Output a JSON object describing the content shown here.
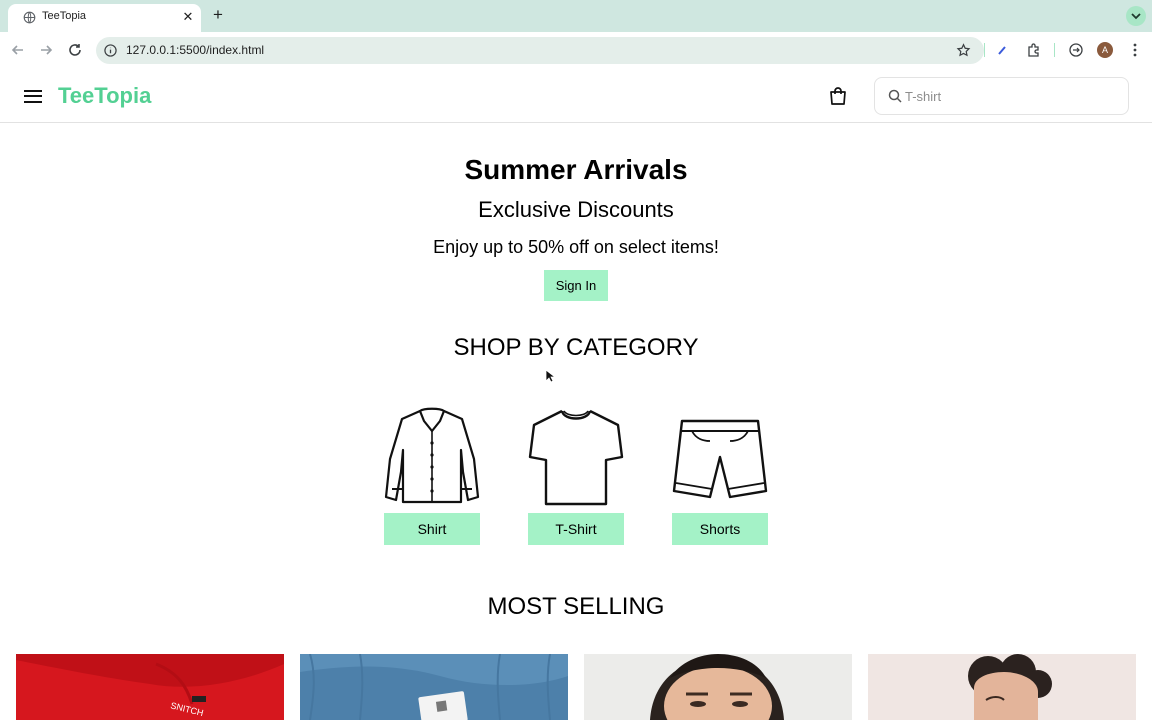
{
  "browser": {
    "tab_title": "TeeTopia",
    "url": "127.0.0.1:5500/index.html",
    "profile_initial": "A"
  },
  "header": {
    "brand": "TeeTopia",
    "search_placeholder": "T-shirt"
  },
  "hero": {
    "title": "Summer Arrivals",
    "subtitle": "Exclusive Discounts",
    "offer": "Enjoy up to 50% off on select items!",
    "cta": "Sign In"
  },
  "categories": {
    "heading": "SHOP BY CATEGORY",
    "items": [
      {
        "label": "Shirt",
        "icon": "shirt-icon"
      },
      {
        "label": "T-Shirt",
        "icon": "tshirt-icon"
      },
      {
        "label": "Shorts",
        "icon": "shorts-icon"
      }
    ]
  },
  "most_selling": {
    "heading": "MOST SELLING",
    "products": [
      {
        "image": "red-tshirt-snitch",
        "tag_text": "SNITCH"
      },
      {
        "image": "blue-sweater-label"
      },
      {
        "image": "man-portrait"
      },
      {
        "image": "man-curly-hair"
      }
    ]
  },
  "colors": {
    "accent": "#53d093",
    "button_bg": "#a4f2c7",
    "chrome_tabbar": "#cfe7e0"
  }
}
